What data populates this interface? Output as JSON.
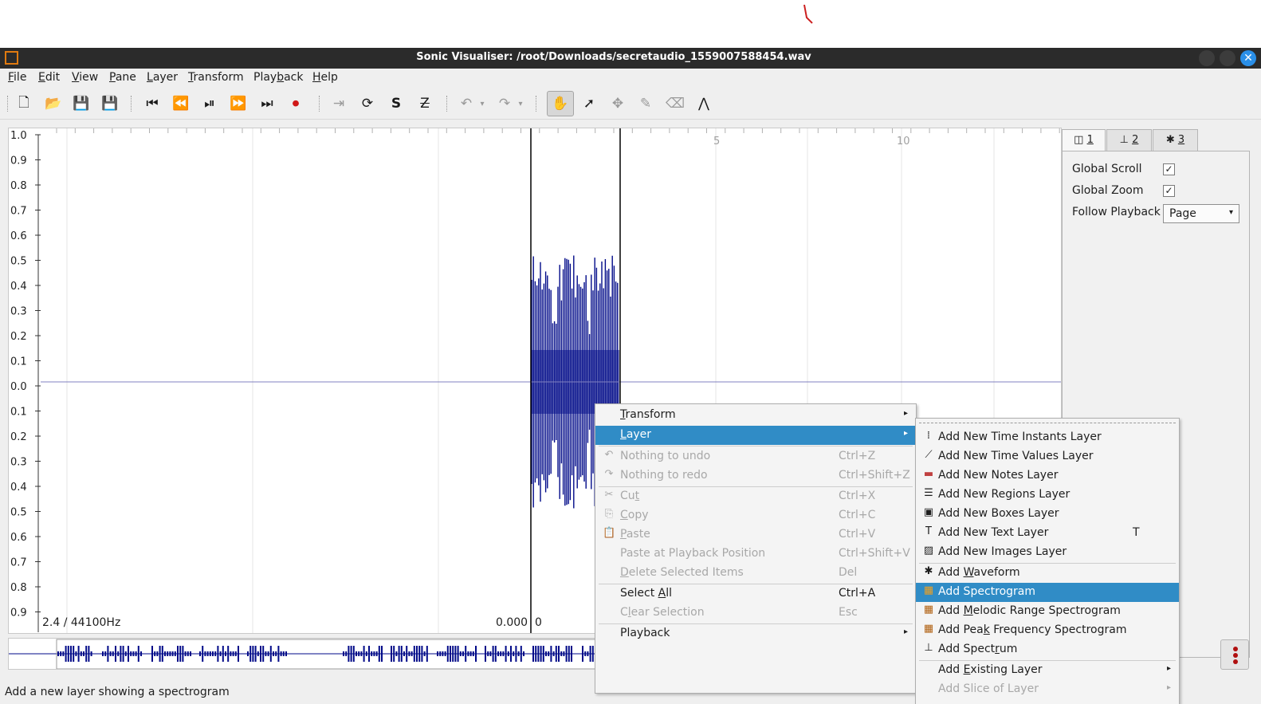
{
  "window": {
    "title": "Sonic Visualiser: /root/Downloads/secretaudio_1559007588454.wav",
    "close_glyph": "✕"
  },
  "menubar": [
    {
      "pre": "",
      "u": "F",
      "post": "ile"
    },
    {
      "pre": "",
      "u": "E",
      "post": "dit"
    },
    {
      "pre": "",
      "u": "V",
      "post": "iew"
    },
    {
      "pre": "",
      "u": "P",
      "post": "ane"
    },
    {
      "pre": "",
      "u": "L",
      "post": "ayer"
    },
    {
      "pre": "",
      "u": "T",
      "post": "ransform"
    },
    {
      "pre": "Play",
      "u": "b",
      "post": "ack"
    },
    {
      "pre": "",
      "u": "H",
      "post": "elp"
    }
  ],
  "toolbar": {
    "icons": {
      "new": "🗋",
      "open": "📂",
      "save": "💾",
      "save_as": "💾",
      "rewind_start": "⏮",
      "rewind": "⏪",
      "play_pause": "⏯",
      "ffwd": "⏩",
      "ffwd_end": "⏭",
      "record": "⏺",
      "play_selection": "⇥",
      "loop": "⟳",
      "solo": "S",
      "speedup": "Z",
      "undo": "↶",
      "redo": "↷",
      "navigate": "✋",
      "select": "➚",
      "move": "✥",
      "draw": "✎",
      "erase": "⌫",
      "measure": "⋀"
    }
  },
  "pane": {
    "y_labels": [
      "1.0",
      "0.9",
      "0.8",
      "0.7",
      "0.6",
      "0.5",
      "0.4",
      "0.3",
      "0.2",
      "0.1",
      "0.0",
      "0.1",
      "0.2",
      "0.3",
      "0.4",
      "0.5",
      "0.6",
      "0.7",
      "0.8",
      "0.9",
      "1.0"
    ],
    "time_ticks": [
      "5",
      "10"
    ],
    "info_left": "2.4 / 44100Hz",
    "info_center": "0.000",
    "info_zero": "0",
    "colors": {
      "waveform": "#000a88",
      "axis_line": "#8080c0",
      "grid": "#e4e4e4"
    }
  },
  "panel": {
    "tabs": [
      {
        "icon": "◫",
        "label": "1"
      },
      {
        "icon": "⊥",
        "label": "2"
      },
      {
        "icon": "✱",
        "label": "3"
      }
    ],
    "global_scroll_label": "Global Scroll",
    "global_zoom_label": "Global Zoom",
    "follow_playback_label": "Follow Playback",
    "follow_playback_value": "Page",
    "checkmark": "✓",
    "global_scroll_checked": true,
    "global_zoom_checked": true
  },
  "context_menu": {
    "items": [
      {
        "id": "transform",
        "pre": "",
        "u": "T",
        "post": "ransform",
        "submenu": true
      },
      {
        "id": "layer",
        "pre": "",
        "u": "L",
        "post": "ayer",
        "submenu": true,
        "highlighted": true
      },
      {
        "id": "undo",
        "pre": "Nothing to undo",
        "u": "",
        "post": "",
        "shortcut": "Ctrl+Z",
        "disabled": true,
        "icon": "↶"
      },
      {
        "id": "redo",
        "pre": "Nothing to redo",
        "u": "",
        "post": "",
        "shortcut": "Ctrl+Shift+Z",
        "disabled": true,
        "icon": "↷"
      },
      {
        "id": "cut",
        "pre": "Cu",
        "u": "t",
        "post": "",
        "shortcut": "Ctrl+X",
        "disabled": true,
        "icon": "✂"
      },
      {
        "id": "copy",
        "pre": "",
        "u": "C",
        "post": "opy",
        "shortcut": "Ctrl+C",
        "disabled": true,
        "icon": "⎘"
      },
      {
        "id": "paste",
        "pre": "",
        "u": "P",
        "post": "aste",
        "shortcut": "Ctrl+V",
        "disabled": true,
        "icon": "📋"
      },
      {
        "id": "paste-at-playback",
        "pre": "Paste at Playback Position",
        "u": "",
        "post": "",
        "shortcut": "Ctrl+Shift+V",
        "disabled": true
      },
      {
        "id": "delete-selected",
        "pre": "",
        "u": "D",
        "post": "elete Selected Items",
        "shortcut": "Del",
        "disabled": true
      },
      {
        "id": "select-all",
        "pre": "Select ",
        "u": "A",
        "post": "ll",
        "shortcut": "Ctrl+A"
      },
      {
        "id": "clear-selection",
        "pre": "C",
        "u": "l",
        "post": "ear Selection",
        "shortcut": "Esc",
        "disabled": true
      },
      {
        "id": "playback",
        "pre": "Playback",
        "u": "",
        "post": "",
        "submenu": true
      }
    ]
  },
  "layer_submenu": {
    "items": [
      {
        "id": "time-instants",
        "pre": "Add New Time Instants Layer",
        "u": "",
        "post": "",
        "icon": "⁞"
      },
      {
        "id": "time-values",
        "pre": "Add New Time Values Layer",
        "u": "",
        "post": "",
        "icon": "⟋"
      },
      {
        "id": "notes",
        "pre": "Add New Notes Layer",
        "u": "",
        "post": "",
        "icon": "▬"
      },
      {
        "id": "regions",
        "pre": "Add New Regions Layer",
        "u": "",
        "post": "",
        "icon": "☰"
      },
      {
        "id": "boxes",
        "pre": "Add New Boxes Layer",
        "u": "",
        "post": "",
        "icon": "▣"
      },
      {
        "id": "text",
        "pre": "Add New Text Layer",
        "u": "",
        "post": "",
        "icon": "T",
        "shortcut": "T"
      },
      {
        "id": "images",
        "pre": "Add New Images Layer",
        "u": "",
        "post": "",
        "icon": "▨"
      },
      {
        "id": "waveform",
        "pre": "Add ",
        "u": "W",
        "post": "aveform",
        "icon": "✱"
      },
      {
        "id": "spectrogram",
        "pre": "Add Spectrogram",
        "u": "",
        "post": "",
        "icon": "▦",
        "highlighted": true
      },
      {
        "id": "melodic",
        "pre": "Add ",
        "u": "M",
        "post": "elodic Range Spectrogram",
        "icon": "▦"
      },
      {
        "id": "peak",
        "pre": "Add Pea",
        "u": "k",
        "post": " Frequency Spectrogram",
        "icon": "▦"
      },
      {
        "id": "spectrum",
        "pre": "Add Spect",
        "u": "r",
        "post": "um",
        "icon": "⊥"
      },
      {
        "id": "existing",
        "pre": "Add ",
        "u": "E",
        "post": "xisting Layer",
        "submenu": true
      },
      {
        "id": "slice",
        "pre": "Add Slice of Layer",
        "u": "",
        "post": "",
        "submenu": true,
        "disabled": true
      }
    ]
  },
  "status": {
    "text": "Add a new layer showing a spectrogram"
  },
  "arrow_glyph": "▸",
  "dropdown_glyph": "▾",
  "layers_button_glyph": "⋮"
}
